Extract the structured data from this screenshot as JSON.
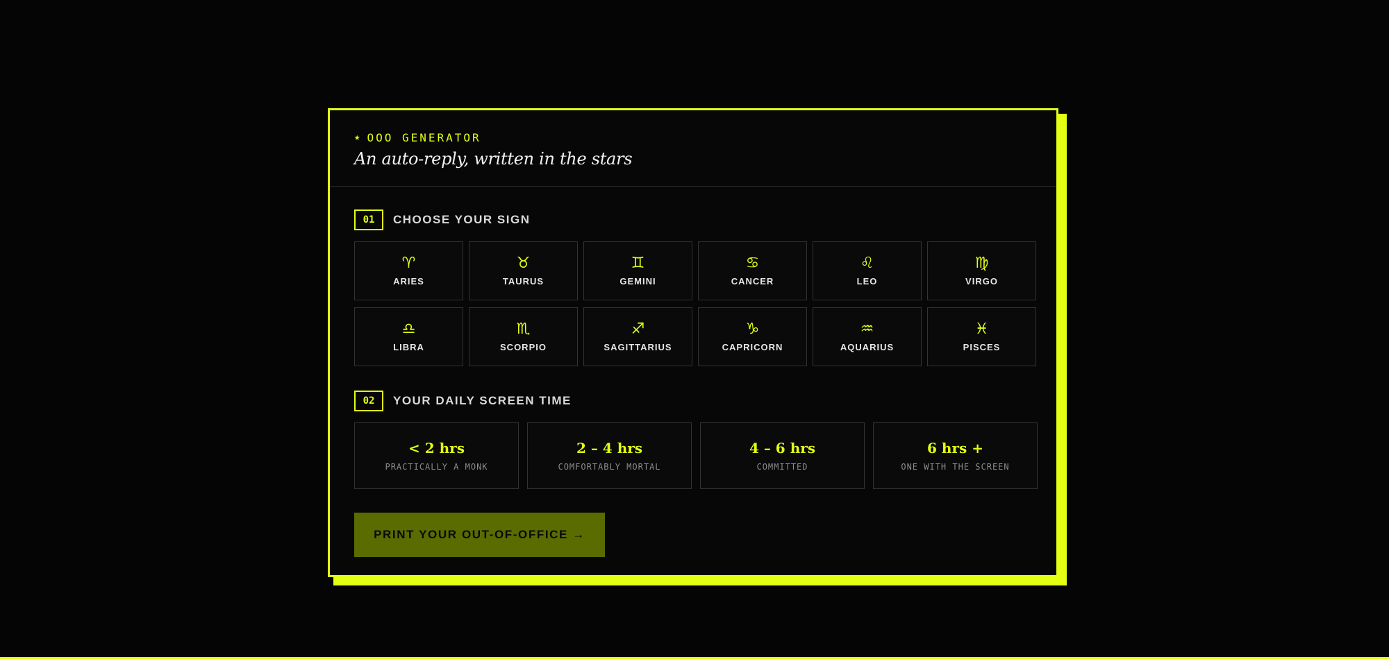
{
  "header": {
    "eyebrow_icon": "star-icon",
    "eyebrow_star": "★",
    "eyebrow": "OOO GENERATOR",
    "subtitle": "An auto-reply, written in the stars"
  },
  "step1": {
    "number": "01",
    "title": "CHOOSE YOUR SIGN",
    "signs": [
      {
        "glyph": "♈",
        "name": "ARIES",
        "icon": "aries-icon"
      },
      {
        "glyph": "♉",
        "name": "TAURUS",
        "icon": "taurus-icon"
      },
      {
        "glyph": "♊",
        "name": "GEMINI",
        "icon": "gemini-icon"
      },
      {
        "glyph": "♋",
        "name": "CANCER",
        "icon": "cancer-icon"
      },
      {
        "glyph": "♌",
        "name": "LEO",
        "icon": "leo-icon"
      },
      {
        "glyph": "♍",
        "name": "VIRGO",
        "icon": "virgo-icon"
      },
      {
        "glyph": "♎",
        "name": "LIBRA",
        "icon": "libra-icon"
      },
      {
        "glyph": "♏",
        "name": "SCORPIO",
        "icon": "scorpio-icon"
      },
      {
        "glyph": "♐",
        "name": "SAGITTARIUS",
        "icon": "sagittarius-icon"
      },
      {
        "glyph": "♑",
        "name": "CAPRICORN",
        "icon": "capricorn-icon"
      },
      {
        "glyph": "♒",
        "name": "AQUARIUS",
        "icon": "aquarius-icon"
      },
      {
        "glyph": "♓",
        "name": "PISCES",
        "icon": "pisces-icon"
      }
    ]
  },
  "step2": {
    "number": "02",
    "title": "YOUR DAILY SCREEN TIME",
    "options": [
      {
        "range": "< 2 hrs",
        "caption": "PRACTICALLY A MONK"
      },
      {
        "range": "2 – 4 hrs",
        "caption": "COMFORTABLY MORTAL"
      },
      {
        "range": "4 – 6 hrs",
        "caption": "COMMITTED"
      },
      {
        "range": "6 hrs +",
        "caption": "ONE WITH THE SCREEN"
      }
    ]
  },
  "action": {
    "print_label": "PRINT YOUR OUT-OF-OFFICE →"
  },
  "colors": {
    "accent": "#e3ff14",
    "background": "#050505",
    "button_disabled": "#5a6b00"
  }
}
